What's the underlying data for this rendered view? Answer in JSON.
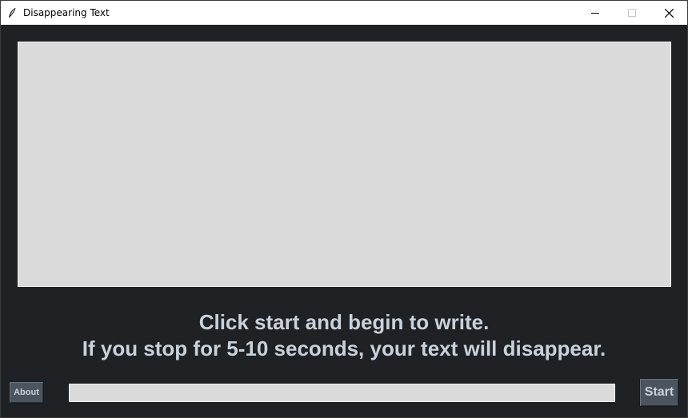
{
  "window": {
    "title": "Disappearing Text",
    "app_icon": "feather-icon",
    "controls": {
      "minimize_icon": "minimize-icon",
      "maximize_icon": "maximize-icon",
      "close_icon": "close-icon"
    }
  },
  "editor": {
    "value": "",
    "placeholder": ""
  },
  "instructions": {
    "line1": "Click start and begin to write.",
    "line2": "If you stop for 5-10 seconds, your text will disappear."
  },
  "footer": {
    "about_label": "About",
    "start_label": "Start",
    "timer_progress": 0
  },
  "colors": {
    "background": "#202124",
    "text_area": "#dadada",
    "instruction_text": "#c9d1db",
    "button_bg": "#4a5560"
  }
}
